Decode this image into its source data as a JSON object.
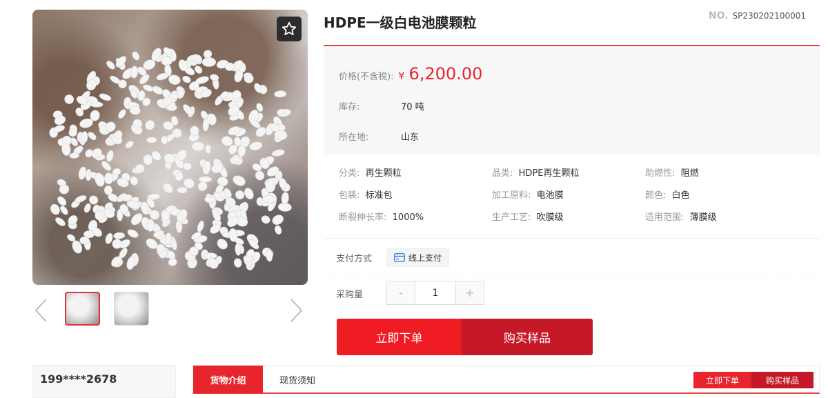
{
  "product": {
    "title": "HDPE一级白电池膜颗粒",
    "no_label": "NO.",
    "no_value": "SP230202100001"
  },
  "gallery": {
    "main_image_alt": "white pellets in hand",
    "favorite_icon": "star-outline-icon",
    "prev_icon": "chevron-left-icon",
    "next_icon": "chevron-right-icon",
    "thumbnail_count": 2
  },
  "pricing": {
    "price_label": "价格(不含税):",
    "currency": "¥",
    "price": "6,200.00",
    "stock_label": "库存:",
    "stock_value": "70 吨",
    "location_label": "所在地:",
    "location_value": "山东"
  },
  "attributes": [
    {
      "key": "分类:",
      "value": "再生颗粒"
    },
    {
      "key": "品类:",
      "value": "HDPE再生颗粒"
    },
    {
      "key": "助燃性:",
      "value": "阻燃"
    },
    {
      "key": "包装:",
      "value": "标准包"
    },
    {
      "key": "加工原料:",
      "value": "电池膜"
    },
    {
      "key": "颜色:",
      "value": "白色"
    },
    {
      "key": "断裂伸长率:",
      "value": "1000%"
    },
    {
      "key": "生产工艺:",
      "value": "吹膜级"
    },
    {
      "key": "适用范围:",
      "value": "薄膜级"
    }
  ],
  "payment": {
    "label": "支付方式",
    "method": "线上支付",
    "icon": "card-icon"
  },
  "quantity": {
    "label": "采购量",
    "minus": "-",
    "value": "1",
    "plus": "+"
  },
  "actions": {
    "order": "立即下单",
    "sample": "购买样品"
  },
  "seller": {
    "phone": "199****2678"
  },
  "tabs": [
    {
      "label": "货物介绍",
      "active": true
    },
    {
      "label": "现货须知",
      "active": false
    }
  ],
  "mini_actions": {
    "order": "立即下单",
    "sample": "购买样品"
  },
  "colors": {
    "accent": "#e8252d",
    "accent_dark": "#c51927"
  }
}
